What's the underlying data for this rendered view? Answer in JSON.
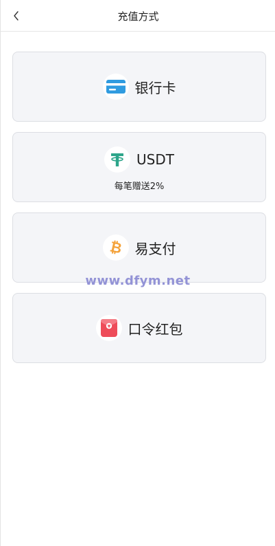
{
  "header": {
    "title": "充值方式",
    "back_icon": "chevron-left-icon"
  },
  "methods": [
    {
      "label": "银行卡",
      "icon": "bank-card-icon",
      "icon_color": "#2f9be0"
    },
    {
      "label": "USDT",
      "icon": "tether-icon",
      "icon_color": "#2da58a",
      "subtitle": "每笔赠送2%"
    },
    {
      "label": "易支付",
      "icon": "bitcoin-icon",
      "icon_color": "#f4a23a"
    },
    {
      "label": "口令红包",
      "icon": "red-envelope-icon",
      "icon_color": "#ee4c59"
    }
  ],
  "watermark": "www.dfym.net"
}
